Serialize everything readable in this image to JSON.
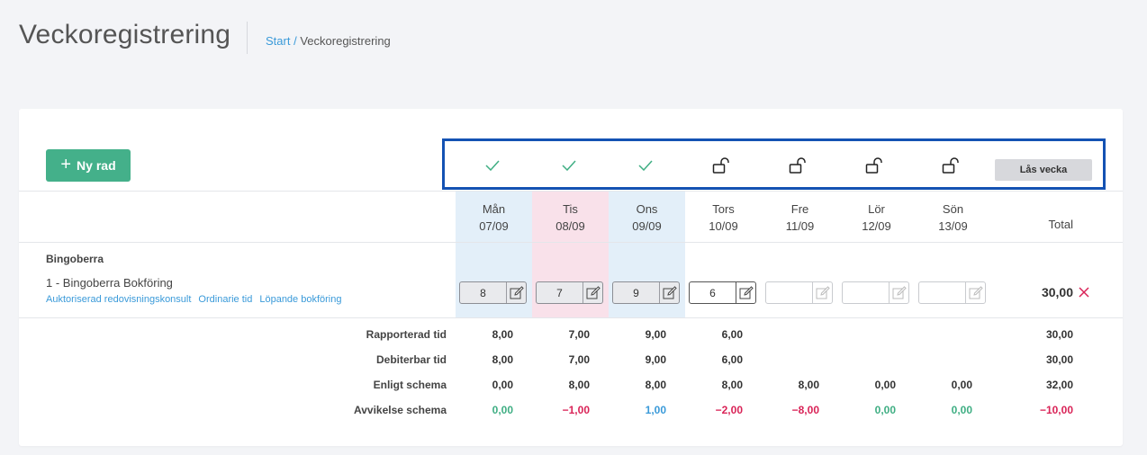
{
  "header": {
    "title": "Veckoregistrering",
    "breadcrumb": {
      "start": "Start",
      "separator": "/",
      "current": "Veckoregistrering"
    }
  },
  "toolbar": {
    "new_row_label": "Ny rad",
    "lock_week_label": "Lås vecka"
  },
  "day_status": [
    "check-icon",
    "check-icon",
    "check-icon",
    "unlock-icon",
    "unlock-icon",
    "unlock-icon",
    "unlock-icon"
  ],
  "days": [
    {
      "name": "Mån",
      "date": "07/09"
    },
    {
      "name": "Tis",
      "date": "08/09"
    },
    {
      "name": "Ons",
      "date": "09/09"
    },
    {
      "name": "Tors",
      "date": "10/09"
    },
    {
      "name": "Fre",
      "date": "11/09"
    },
    {
      "name": "Lör",
      "date": "12/09"
    },
    {
      "name": "Sön",
      "date": "13/09"
    }
  ],
  "total_header": "Total",
  "row": {
    "customer": "Bingoberra",
    "activity": "1 - Bingoberra Bokföring",
    "tags": [
      "Auktoriserad redovisningskonsult",
      "Ordinarie tid",
      "Löpande bokföring"
    ],
    "hours": [
      "8",
      "7",
      "9",
      "6",
      "",
      "",
      ""
    ],
    "total": "30,00"
  },
  "summary": [
    {
      "label": "Rapporterad tid",
      "values": [
        "8,00",
        "7,00",
        "9,00",
        "6,00",
        "",
        "",
        ""
      ],
      "total": "30,00"
    },
    {
      "label": "Debiterbar tid",
      "values": [
        "8,00",
        "7,00",
        "9,00",
        "6,00",
        "",
        "",
        ""
      ],
      "total": "30,00"
    },
    {
      "label": "Enligt schema",
      "values": [
        "0,00",
        "8,00",
        "8,00",
        "8,00",
        "8,00",
        "0,00",
        "0,00"
      ],
      "total": "32,00"
    },
    {
      "label": "Avvikelse schema",
      "values": [
        "0,00",
        "−1,00",
        "1,00",
        "−2,00",
        "−8,00",
        "0,00",
        "0,00"
      ],
      "total": "−10,00"
    }
  ],
  "colors": {
    "accent_green": "#44b08a",
    "positive": "#3fae83",
    "negative": "#d92357",
    "link": "#3a9ad9",
    "col_blue": "#e3eff9",
    "col_pink": "#f9e1ea",
    "highlight_border": "#1452b3"
  }
}
